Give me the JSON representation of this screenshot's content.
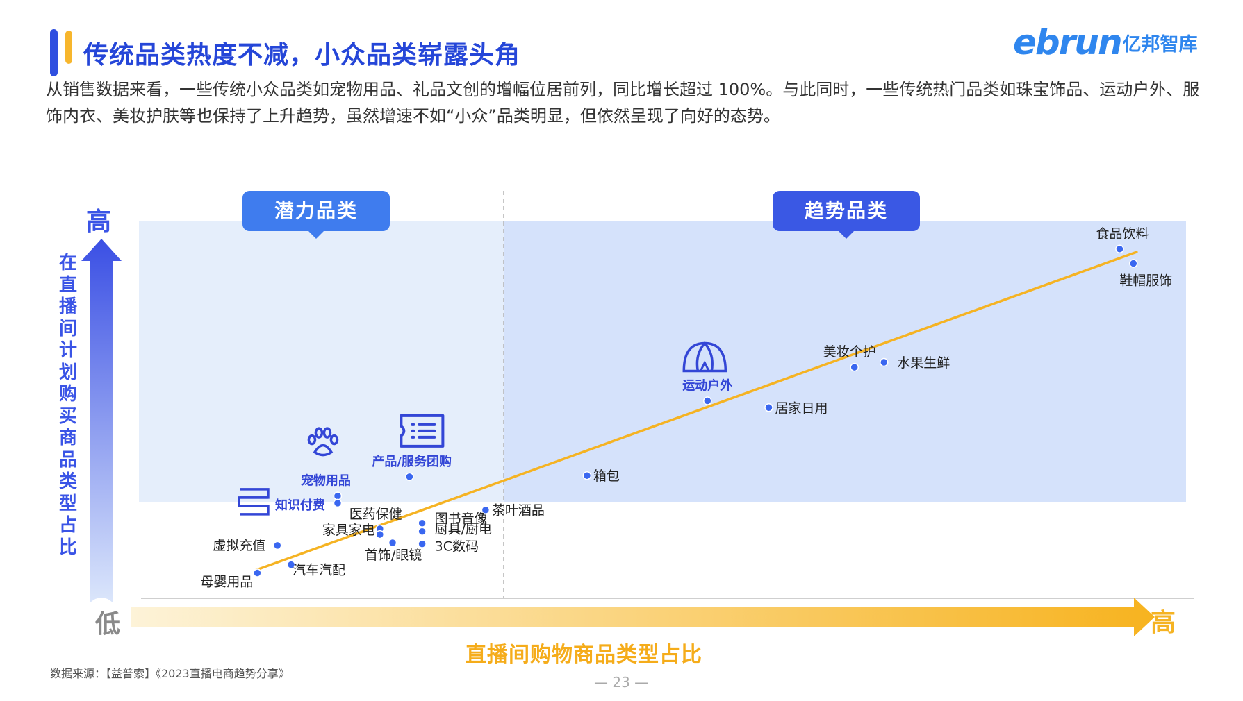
{
  "header": {
    "title": "传统品类热度不减，小众品类崭露头角",
    "logo_mark": "ebrun",
    "logo_cn": "亿邦智库"
  },
  "intro": {
    "text": "从销售数据来看，一些传统小众品类如宠物用品、礼品文创的增幅位居前列，同比增长超过 100%。与此同时，一些传统热门品类如珠宝饰品、运动户外、服饰内衣、美妆护肤等也保持了上升趋势，虽然增速不如“小众”品类明显，但依然呈现了向好的态势。"
  },
  "quadrants": {
    "left_label": "潜力品类",
    "right_label": "趋势品类"
  },
  "colors": {
    "dot": "#3a67f0",
    "trend_line": "#f5b323",
    "icon": "#3346d6",
    "left_bg": "#e5eefb",
    "right_bg": "#d5e2fb",
    "title": "#2546d8"
  },
  "chart_data": {
    "type": "scatter",
    "title": "",
    "xlabel": "直播间购物商品类型占比",
    "ylabel": "在直播间计划购买商品类型占比",
    "x_high_label": "高",
    "x_low_label": "低",
    "y_high_label": "高",
    "x_range": [
      0,
      100
    ],
    "y_range": [
      0,
      100
    ],
    "quadrant_divider_x": 34.6,
    "quadrant_divider_y": 18.8,
    "trend_line": [
      [
        11.1,
        7.5
      ],
      [
        94.4,
        91.7
      ]
    ],
    "points": [
      {
        "name": "食品饮料",
        "x": 92.8,
        "y": 92.5,
        "icon": "",
        "highlight": false
      },
      {
        "name": "鞋帽服饰",
        "x": 94.1,
        "y": 88.7,
        "icon": "",
        "highlight": false
      },
      {
        "name": "美妆个护",
        "x": 67.7,
        "y": 61.2,
        "icon": "",
        "highlight": false
      },
      {
        "name": "水果生鲜",
        "x": 70.5,
        "y": 62.5,
        "icon": "",
        "highlight": false
      },
      {
        "name": "运动户外",
        "x": 53.8,
        "y": 52.3,
        "icon": "tent-icon",
        "highlight": true
      },
      {
        "name": "居家日用",
        "x": 59.6,
        "y": 50.5,
        "icon": "",
        "highlight": false
      },
      {
        "name": "箱包",
        "x": 42.4,
        "y": 32.5,
        "icon": "",
        "highlight": false
      },
      {
        "name": "产品/服务团购",
        "x": 25.6,
        "y": 32.2,
        "icon": "ticket-icon",
        "highlight": true
      },
      {
        "name": "宠物用品",
        "x": 18.8,
        "y": 27.1,
        "icon": "paw-icon",
        "highlight": true
      },
      {
        "name": "知识付费",
        "x": 18.8,
        "y": 25.2,
        "icon": "books-icon",
        "highlight": true
      },
      {
        "name": "茶叶酒品",
        "x": 32.8,
        "y": 23.4,
        "icon": "",
        "highlight": false
      },
      {
        "name": "医药保健",
        "x": 22.8,
        "y": 18.4,
        "icon": "",
        "highlight": false
      },
      {
        "name": "家具家电",
        "x": 22.8,
        "y": 16.9,
        "icon": "",
        "highlight": false
      },
      {
        "name": "首饰/眼镜",
        "x": 24.0,
        "y": 14.7,
        "icon": "",
        "highlight": false
      },
      {
        "name": "图书音像",
        "x": 26.8,
        "y": 19.9,
        "icon": "",
        "highlight": false
      },
      {
        "name": "厨具/厨电",
        "x": 26.8,
        "y": 17.7,
        "icon": "",
        "highlight": false
      },
      {
        "name": "3C数码",
        "x": 26.8,
        "y": 14.4,
        "icon": "",
        "highlight": false
      },
      {
        "name": "虚拟充值",
        "x": 13.1,
        "y": 14.0,
        "icon": "",
        "highlight": false
      },
      {
        "name": "汽车汽配",
        "x": 14.4,
        "y": 8.9,
        "icon": "",
        "highlight": false
      },
      {
        "name": "母婴用品",
        "x": 11.2,
        "y": 6.7,
        "icon": "",
        "highlight": false
      }
    ]
  },
  "footer": {
    "source": "数据来源：【益普索】《2023直播电商趋势分享》",
    "page": "— 23 —"
  }
}
